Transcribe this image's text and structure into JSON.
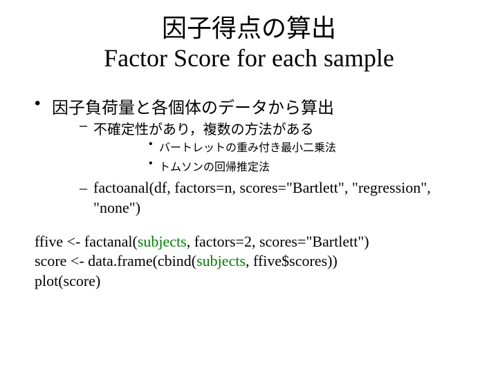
{
  "title": {
    "line1": "因子得点の算出",
    "line2": "Factor Score for each sample"
  },
  "bullets": {
    "level1": "因子負荷量と各個体のデータから算出",
    "level2_1": "不確定性があり，複数の方法がある",
    "level3_1": "バートレットの重み付き最小二乗法",
    "level3_2": "トムソンの回帰推定法",
    "level2_2": "factoanal(df, factors=n, scores=\"Bartlett\", \"regression\", \"none\")"
  },
  "code": {
    "line1_pre": "ffive <-  factanal(",
    "line1_sub": "subjects",
    "line1_post": ", factors=2, scores=\"Bartlett\")",
    "line2_pre": "score <- data.frame(cbind(",
    "line2_sub": "subjects",
    "line2_post": ", ffive$scores))",
    "line3": "plot(score)"
  }
}
